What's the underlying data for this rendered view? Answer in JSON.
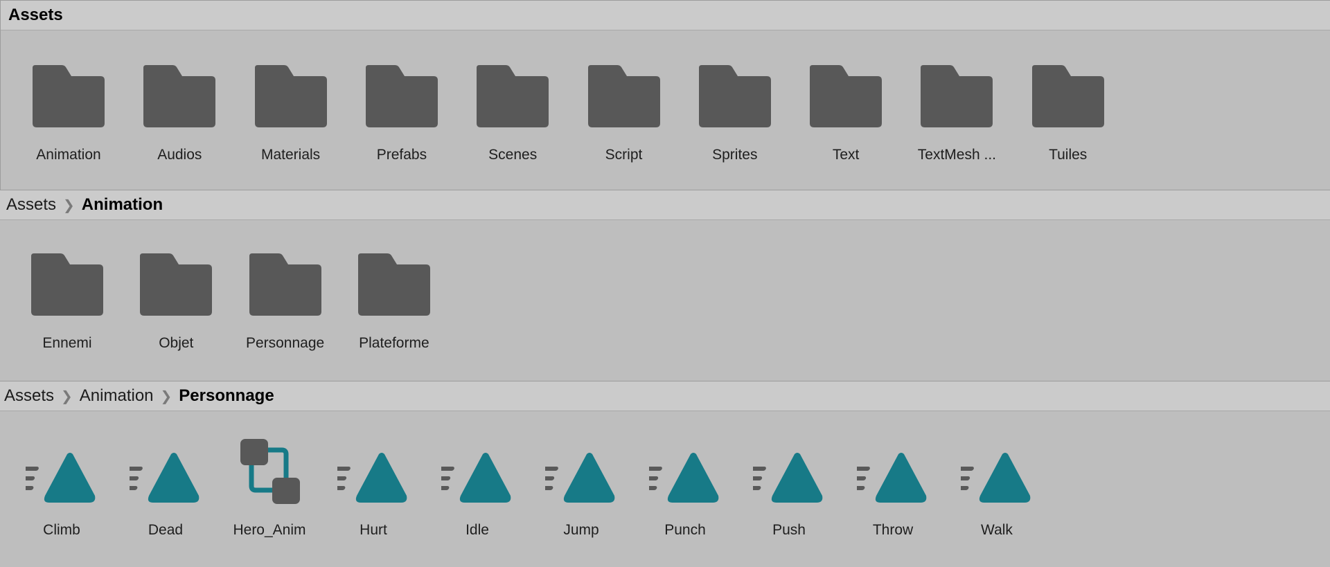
{
  "colors": {
    "folder": "#585858",
    "anim": "#177a87",
    "bar": "#cbcbcb",
    "bg": "#bebebe"
  },
  "panel1": {
    "breadcrumb": [
      "Assets"
    ],
    "items": [
      {
        "label": "Animation",
        "icon": "folder-icon"
      },
      {
        "label": "Audios",
        "icon": "folder-icon"
      },
      {
        "label": "Materials",
        "icon": "folder-icon"
      },
      {
        "label": "Prefabs",
        "icon": "folder-icon"
      },
      {
        "label": "Scenes",
        "icon": "folder-icon"
      },
      {
        "label": "Script",
        "icon": "folder-icon"
      },
      {
        "label": "Sprites",
        "icon": "folder-icon"
      },
      {
        "label": "Text",
        "icon": "folder-icon"
      },
      {
        "label": "TextMesh ...",
        "icon": "folder-icon"
      },
      {
        "label": "Tuiles",
        "icon": "folder-icon"
      }
    ]
  },
  "panel2": {
    "breadcrumb": [
      "Assets",
      "Animation"
    ],
    "items": [
      {
        "label": "Ennemi",
        "icon": "folder-icon"
      },
      {
        "label": "Objet",
        "icon": "folder-icon"
      },
      {
        "label": "Personnage",
        "icon": "folder-icon"
      },
      {
        "label": "Plateforme",
        "icon": "folder-icon"
      }
    ]
  },
  "panel3": {
    "breadcrumb": [
      "Assets",
      "Animation",
      "Personnage"
    ],
    "items": [
      {
        "label": "Climb",
        "icon": "animation-clip-icon"
      },
      {
        "label": "Dead",
        "icon": "animation-clip-icon"
      },
      {
        "label": "Hero_Anim",
        "icon": "animator-controller-icon"
      },
      {
        "label": "Hurt",
        "icon": "animation-clip-icon"
      },
      {
        "label": "Idle",
        "icon": "animation-clip-icon"
      },
      {
        "label": "Jump",
        "icon": "animation-clip-icon"
      },
      {
        "label": "Punch",
        "icon": "animation-clip-icon"
      },
      {
        "label": "Push",
        "icon": "animation-clip-icon"
      },
      {
        "label": "Throw",
        "icon": "animation-clip-icon"
      },
      {
        "label": "Walk",
        "icon": "animation-clip-icon"
      }
    ]
  }
}
